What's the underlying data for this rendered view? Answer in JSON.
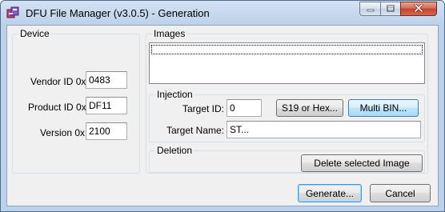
{
  "window": {
    "title": "DFU File Manager (v3.0.5) - Generation",
    "icon": "app-package-icon"
  },
  "title_controls": [
    "minimize-icon",
    "maximize-icon",
    "close-icon"
  ],
  "device": {
    "group_label": "Device",
    "vendor_label": "Vendor ID 0x",
    "vendor_value": "0483",
    "product_label": "Product ID 0x",
    "product_value": "DF11",
    "version_label": "Version 0x",
    "version_value": "2100"
  },
  "images": {
    "group_label": "Images",
    "items": [
      ""
    ]
  },
  "injection": {
    "group_label": "Injection",
    "target_id_label": "Target ID:",
    "target_id_value": "0",
    "s19_button": "S19 or Hex...",
    "multibin_button": "Multi BIN...",
    "target_name_label": "Target Name:",
    "target_name_value": "ST..."
  },
  "deletion": {
    "group_label": "Deletion",
    "delete_button": "Delete selected Image"
  },
  "footer": {
    "generate_button": "Generate...",
    "cancel_button": "Cancel"
  }
}
